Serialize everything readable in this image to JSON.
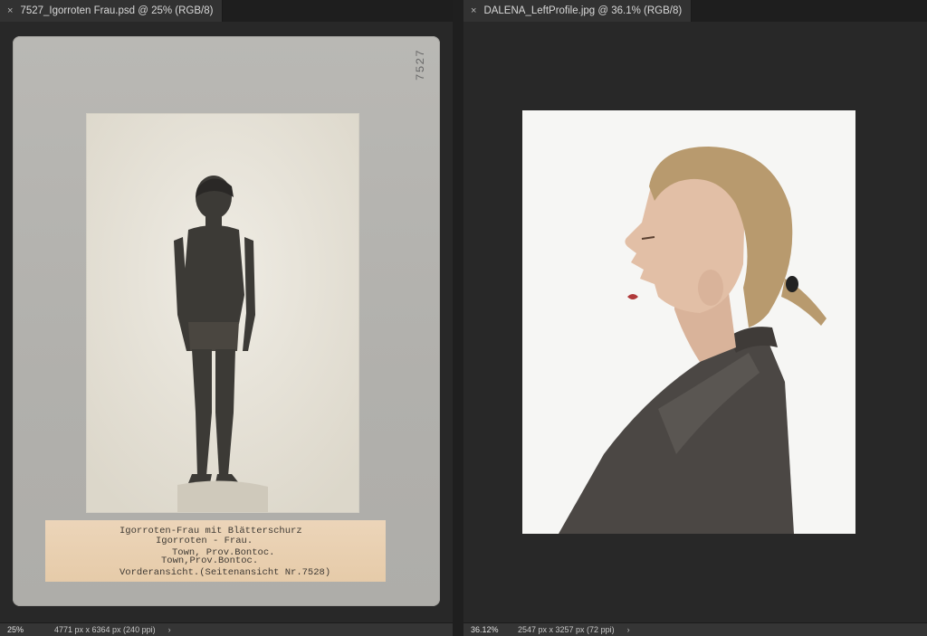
{
  "left_doc": {
    "tab_title": "7527_Igorroten Frau.psd @ 25% (RGB/8)",
    "zoom": "25%",
    "doc_info": "4771 px x 6364 px (240 ppi)",
    "mount_number": "7527",
    "label_lines": [
      "Igorroten-Frau mit Blätterschurz",
      "Igorroten - Frau.",
      "Town, Prov.Bontoc.",
      "Town,Prov.Bontoc.",
      "Vorderansicht.(Seitenansicht Nr.7528)"
    ]
  },
  "right_doc": {
    "tab_title": "DALENA_LeftProfile.jpg @ 36.1% (RGB/8)",
    "zoom": "36.12%",
    "doc_info": "2547 px x 3257 px (72 ppi)"
  },
  "icons": {
    "close": "×",
    "chevron": "›"
  }
}
